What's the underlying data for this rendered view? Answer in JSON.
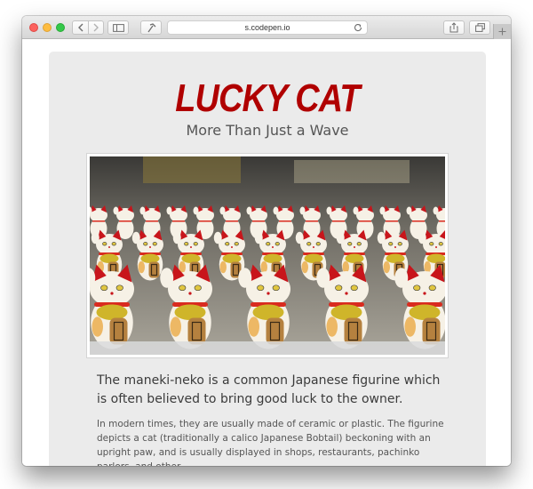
{
  "browser": {
    "url": "s.codepen.io"
  },
  "page": {
    "title": "LUCKY CAT",
    "subtitle": "More Than Just a Wave",
    "lead": "The maneki-neko is a common Japanese figurine which is often believed to bring good luck to the owner.",
    "body": "In modern times, they are usually made of ceramic or plastic. The figurine depicts a cat (traditionally a calico Japanese Bobtail) beckoning with an upright paw, and is usually displayed in shops, restaurants, pachinko parlors, and other"
  },
  "icons": {
    "back": "chevron-left-icon",
    "forward": "chevron-right-icon",
    "sidebar": "sidebar-icon",
    "tools": "hammer-icon",
    "reload": "reload-icon",
    "share": "share-icon",
    "tabs": "tabs-icon",
    "new_tab": "plus-icon"
  },
  "colors": {
    "title": "#b00000",
    "card_background": "#ebebeb",
    "cat_body": "#f6f1e6",
    "cat_ears": "#c8151b",
    "cat_collar": "#d92b1f",
    "bib_gold": "#cfb52a",
    "coin_brown": "#b5813f"
  }
}
